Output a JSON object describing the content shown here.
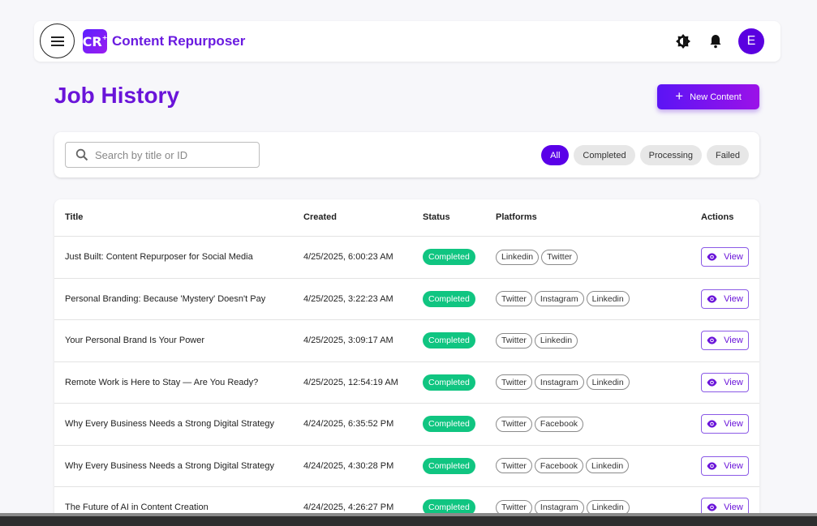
{
  "app": {
    "logo_text": "CR",
    "logo_sup": "+",
    "title": "Content Repurposer",
    "avatar_initial": "E"
  },
  "colors": {
    "accent": "#6a14d9",
    "brand_primary": "#5a00e8",
    "status_completed": "#10c581"
  },
  "page": {
    "title": "Job History",
    "new_button_label": "New Content"
  },
  "search": {
    "placeholder": "Search by title or ID",
    "value": ""
  },
  "filters": [
    {
      "label": "All",
      "active": true
    },
    {
      "label": "Completed",
      "active": false
    },
    {
      "label": "Processing",
      "active": false
    },
    {
      "label": "Failed",
      "active": false
    }
  ],
  "table": {
    "headers": {
      "title": "Title",
      "created": "Created",
      "status": "Status",
      "platforms": "Platforms",
      "actions": "Actions"
    },
    "view_label": "View",
    "rows": [
      {
        "title": "Just Built: Content Repurposer for Social Media",
        "created": "4/25/2025, 6:00:23 AM",
        "status": "Completed",
        "platforms": [
          "Linkedin",
          "Twitter"
        ]
      },
      {
        "title": "Personal Branding: Because 'Mystery' Doesn't Pay",
        "created": "4/25/2025, 3:22:23 AM",
        "status": "Completed",
        "platforms": [
          "Twitter",
          "Instagram",
          "Linkedin"
        ]
      },
      {
        "title": "Your Personal Brand Is Your Power",
        "created": "4/25/2025, 3:09:17 AM",
        "status": "Completed",
        "platforms": [
          "Twitter",
          "Linkedin"
        ]
      },
      {
        "title": "Remote Work is Here to Stay — Are You Ready?",
        "created": "4/25/2025, 12:54:19 AM",
        "status": "Completed",
        "platforms": [
          "Twitter",
          "Instagram",
          "Linkedin"
        ]
      },
      {
        "title": "Why Every Business Needs a Strong Digital Strategy",
        "created": "4/24/2025, 6:35:52 PM",
        "status": "Completed",
        "platforms": [
          "Twitter",
          "Facebook"
        ]
      },
      {
        "title": "Why Every Business Needs a Strong Digital Strategy",
        "created": "4/24/2025, 4:30:28 PM",
        "status": "Completed",
        "platforms": [
          "Twitter",
          "Facebook",
          "Linkedin"
        ]
      },
      {
        "title": "The Future of AI in Content Creation",
        "created": "4/24/2025, 4:26:27 PM",
        "status": "Completed",
        "platforms": [
          "Twitter",
          "Instagram",
          "Linkedin"
        ]
      }
    ]
  }
}
